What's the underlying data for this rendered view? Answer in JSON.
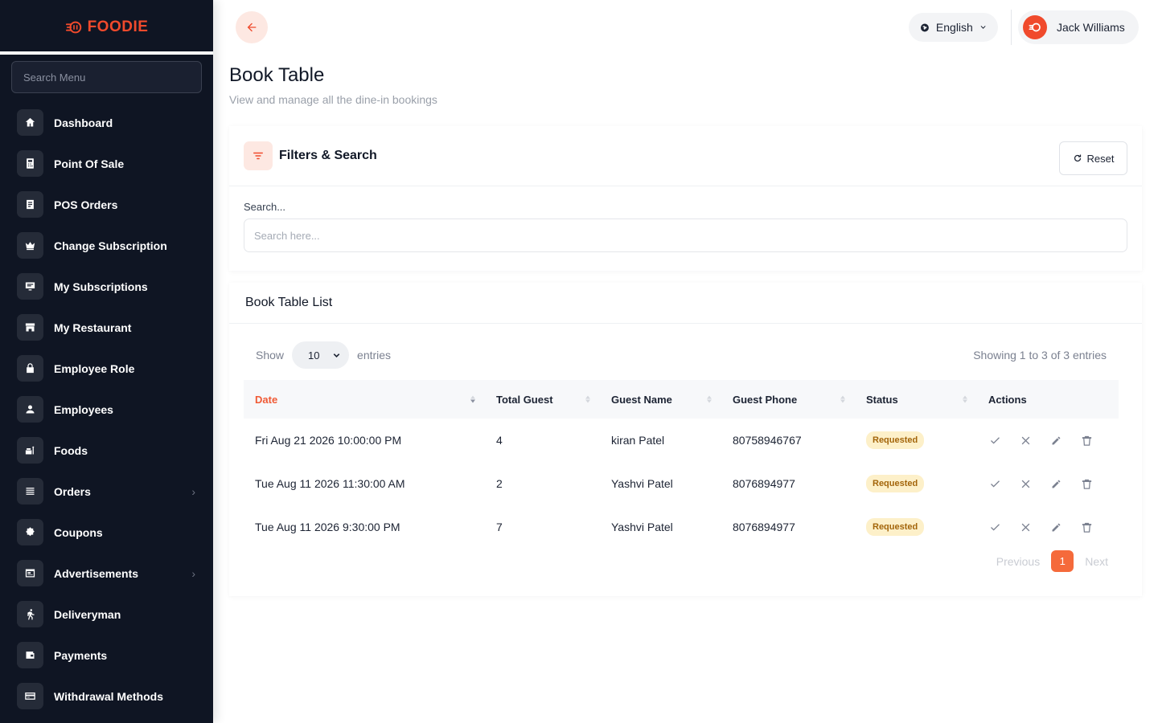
{
  "app": {
    "logo_text": "FOODIE",
    "accent": "#f04a2c"
  },
  "sidebar": {
    "search_placeholder": "Search Menu",
    "items": [
      {
        "label": "Dashboard",
        "icon": "home-icon"
      },
      {
        "label": "Point Of Sale",
        "icon": "calculator-icon"
      },
      {
        "label": "POS Orders",
        "icon": "receipt-icon"
      },
      {
        "label": "Change Subscription",
        "icon": "crown-icon"
      },
      {
        "label": "My Subscriptions",
        "icon": "monitor-icon"
      },
      {
        "label": "My Restaurant",
        "icon": "store-icon"
      },
      {
        "label": "Employee Role",
        "icon": "lock-icon"
      },
      {
        "label": "Employees",
        "icon": "user-icon"
      },
      {
        "label": "Foods",
        "icon": "food-icon"
      },
      {
        "label": "Orders",
        "icon": "list-icon",
        "expandable": true
      },
      {
        "label": "Coupons",
        "icon": "badge-percent-icon"
      },
      {
        "label": "Advertisements",
        "icon": "ad-icon",
        "expandable": true
      },
      {
        "label": "Deliveryman",
        "icon": "runner-icon"
      },
      {
        "label": "Payments",
        "icon": "wallet-icon"
      },
      {
        "label": "Withdrawal Methods",
        "icon": "credit-card-icon"
      }
    ]
  },
  "header": {
    "language": "English",
    "user_name": "Jack Williams"
  },
  "page": {
    "title": "Book Table",
    "subtitle": "View and manage all the dine-in bookings"
  },
  "filters": {
    "title": "Filters & Search",
    "reset_label": "Reset",
    "search_label": "Search...",
    "search_placeholder": "Search here..."
  },
  "list": {
    "title": "Book Table List",
    "show_label": "Show",
    "entries_value": "10",
    "entries_label": "entries",
    "showing_text": "Showing 1 to 3 of 3 entries",
    "columns": [
      "Date",
      "Total Guest",
      "Guest Name",
      "Guest Phone",
      "Status",
      "Actions"
    ],
    "rows": [
      {
        "date": "Fri Aug 21 2026 10:00:00 PM",
        "guests": "4",
        "name": "kiran Patel",
        "phone": "80758946767",
        "status": "Requested"
      },
      {
        "date": "Tue Aug 11 2026 11:30:00 AM",
        "guests": "2",
        "name": "Yashvi Patel",
        "phone": "8076894977",
        "status": "Requested"
      },
      {
        "date": "Tue Aug 11 2026 9:30:00 PM",
        "guests": "7",
        "name": "Yashvi Patel",
        "phone": "8076894977",
        "status": "Requested"
      }
    ],
    "pagination": {
      "previous": "Previous",
      "current": "1",
      "next": "Next"
    }
  }
}
